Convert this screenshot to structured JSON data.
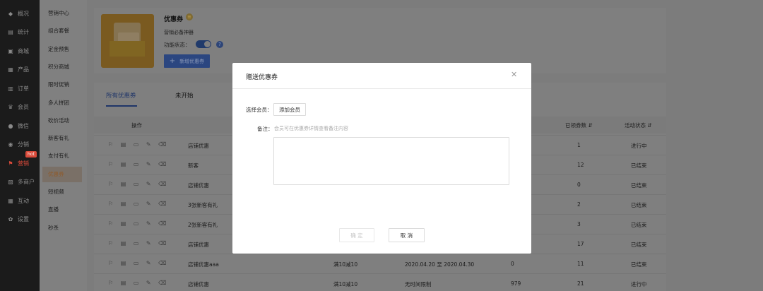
{
  "nav": [
    {
      "label": "概况",
      "icon": "dashboard-icon"
    },
    {
      "label": "统计",
      "icon": "chart-icon"
    },
    {
      "label": "商城",
      "icon": "store-icon"
    },
    {
      "label": "产品",
      "icon": "grid-icon"
    },
    {
      "label": "订单",
      "icon": "order-icon"
    },
    {
      "label": "会员",
      "icon": "crown-icon"
    },
    {
      "label": "微信",
      "icon": "wechat-icon"
    },
    {
      "label": "分销",
      "icon": "share-icon"
    },
    {
      "label": "营销",
      "icon": "flag-icon",
      "badge": "hot"
    },
    {
      "label": "多商户",
      "icon": "merchant-icon"
    },
    {
      "label": "互动",
      "icon": "interact-icon"
    },
    {
      "label": "设置",
      "icon": "gear-icon"
    }
  ],
  "submenu": [
    "营销中心",
    "组合套餐",
    "定金预售",
    "积分商城",
    "限时促销",
    "多人拼团",
    "砍价活动",
    "新客有礼",
    "支付有礼",
    "优惠券",
    "短视频",
    "直播",
    "秒杀"
  ],
  "header": {
    "title": "优惠券",
    "subtitle": "营销必备神器",
    "status_label": "功能状态：",
    "new_button": "新增优惠券"
  },
  "tabs": [
    "所有优惠券",
    "未开始"
  ],
  "table": {
    "headers": [
      "操作",
      "已领券数",
      "活动状态"
    ],
    "rows": [
      {
        "name": "店铺优惠",
        "cond": "",
        "date": "",
        "used": "",
        "claimed": "1",
        "status": "进行中"
      },
      {
        "name": "新客",
        "cond": "",
        "date": "",
        "used": "",
        "claimed": "12",
        "status": "已结束"
      },
      {
        "name": "店铺优惠",
        "cond": "",
        "date": "",
        "used": "",
        "claimed": "0",
        "status": "已结束"
      },
      {
        "name": "3张新客有礼",
        "cond": "",
        "date": "",
        "used": "",
        "claimed": "2",
        "status": "已结束"
      },
      {
        "name": "2张新客有礼",
        "cond": "",
        "date": "",
        "used": "",
        "claimed": "3",
        "status": "已结束"
      },
      {
        "name": "店铺优惠",
        "cond": "",
        "date": "",
        "used": "",
        "claimed": "17",
        "status": "已结束"
      },
      {
        "name": "店铺优惠aaa",
        "cond": "满10减10",
        "date": "2020.04.20 至 2020.04.30",
        "used": "0",
        "claimed": "11",
        "status": "已结束"
      },
      {
        "name": "店铺优惠",
        "cond": "满10减10",
        "date": "无时间限制",
        "used": "979",
        "claimed": "21",
        "status": "进行中"
      }
    ]
  },
  "dialog": {
    "title": "赠送优惠券",
    "member_label": "选择会员：",
    "add_member": "添加会员",
    "note_label": "备注：",
    "note_placeholder": "会员可在优惠券详情查看备注内容",
    "ok": "确 定",
    "cancel": "取 消"
  }
}
